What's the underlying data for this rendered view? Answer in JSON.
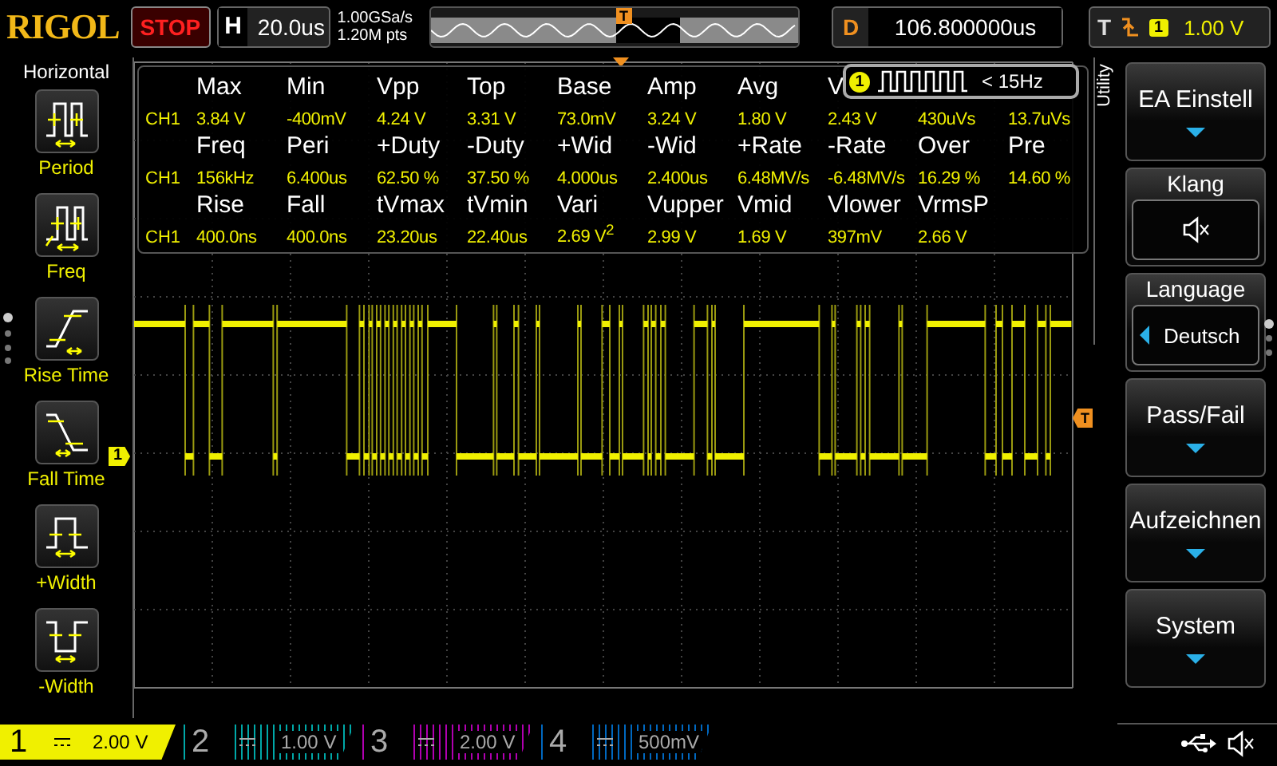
{
  "top_bar": {
    "logo": "RIGOL",
    "run_state": "STOP",
    "timebase": {
      "label": "H",
      "value": "20.0us"
    },
    "sample_rate": "1.00GSa/s",
    "memory_depth": "1.20M pts",
    "timeline_marker": "T",
    "delay": {
      "label": "D",
      "value": "106.800000us"
    },
    "trigger": {
      "label": "T",
      "channel": "1",
      "level": "1.00 V"
    }
  },
  "measure_menu": {
    "title": "Horizontal",
    "items": [
      {
        "label": "Period",
        "kind": "period"
      },
      {
        "label": "Freq",
        "kind": "freq"
      },
      {
        "label": "Rise Time",
        "kind": "rise"
      },
      {
        "label": "Fall Time",
        "kind": "fall"
      },
      {
        "label": "+Width",
        "kind": "pwidth"
      },
      {
        "label": "-Width",
        "kind": "nwidth"
      }
    ]
  },
  "display": {
    "channel_marker": "1",
    "trigger_marker": "T",
    "measurements": [
      {
        "headers": [
          "Max",
          "Min",
          "Vpp",
          "Top",
          "Base",
          "Amp",
          "Avg",
          "V"
        ],
        "channel": "CH1",
        "values": [
          "3.84 V",
          "-400mV",
          "4.24 V",
          "3.31 V",
          "73.0mV",
          "3.24 V",
          "1.80 V",
          "2.43 V",
          "430uVs",
          "13.7uVs"
        ]
      },
      {
        "headers": [
          "Freq",
          "Peri",
          "+Duty",
          "-Duty",
          "+Wid",
          "-Wid",
          "+Rate",
          "-Rate",
          "Over",
          "Pre"
        ],
        "channel": "CH1",
        "values": [
          "156kHz",
          "6.400us",
          "62.50 %",
          "37.50 %",
          "4.000us",
          "2.400us",
          "6.48MV/s",
          "-6.48MV/s",
          "16.29 %",
          "14.60 %"
        ]
      },
      {
        "headers": [
          "Rise",
          "Fall",
          "tVmax",
          "tVmin",
          "Vari",
          "Vupper",
          "Vmid",
          "Vlower",
          "VrmsP"
        ],
        "channel": "CH1",
        "values": [
          "400.0ns",
          "400.0ns",
          "23.20us",
          "22.40us",
          "2.69 V$^{2}$",
          "2.99 V",
          "1.69 V",
          "397mV",
          "2.66 V"
        ]
      }
    ],
    "counter": {
      "channel": "1",
      "reading": "< 15Hz"
    }
  },
  "utility_menu": {
    "title": "Utility",
    "items": [
      {
        "kind": "submenu",
        "label": "EA Einstell"
      },
      {
        "kind": "sound",
        "label": "Klang",
        "muted": true
      },
      {
        "kind": "select",
        "label": "Language",
        "value": "Deutsch"
      },
      {
        "kind": "submenu",
        "label": "Pass/Fail"
      },
      {
        "kind": "submenu",
        "label": "Aufzeichnen"
      },
      {
        "kind": "submenu",
        "label": "System"
      }
    ]
  },
  "channels": [
    {
      "number": "1",
      "scale": "2.00 V",
      "on": true,
      "color": "#f0f000"
    },
    {
      "number": "2",
      "scale": "1.00 V",
      "on": false,
      "color": "#00a8a8"
    },
    {
      "number": "3",
      "scale": "2.00 V",
      "on": false,
      "color": "#b000b0"
    },
    {
      "number": "4",
      "scale": "500mV",
      "on": false,
      "color": "#0068c0"
    }
  ]
}
